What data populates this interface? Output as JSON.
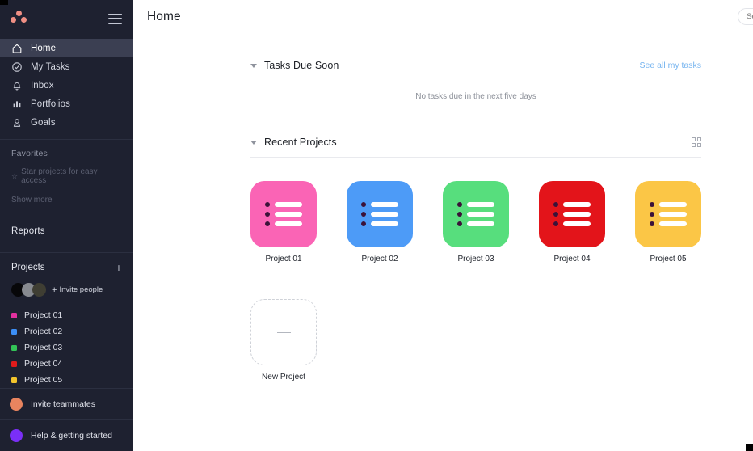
{
  "theme": {
    "sidebar_bg": "#1e2130",
    "sidebar_active_bg": "#3b3f52",
    "accent_link": "#74b3ef",
    "logo_color": "#ef8f84"
  },
  "sidebar": {
    "logo_name": "asana-logo",
    "menu_toggle_label": "",
    "nav_items": [
      {
        "label": "Home",
        "icon": "home-icon",
        "active": true
      },
      {
        "label": "My Tasks",
        "icon": "check-circle-icon",
        "active": false
      },
      {
        "label": "Inbox",
        "icon": "bell-icon",
        "active": false
      },
      {
        "label": "Portfolios",
        "icon": "bar-chart-icon",
        "active": false
      },
      {
        "label": "Goals",
        "icon": "goal-person-icon",
        "active": false
      }
    ],
    "favorites": {
      "title": "Favorites",
      "empty_hint": "Star projects for easy access",
      "show_more": "Show more"
    },
    "reports": {
      "title": "Reports"
    },
    "projects": {
      "title": "Projects",
      "add_label": "+",
      "invite_people": "Invite people",
      "avatars": [
        "#070709",
        "#878a90",
        "#3f3e33"
      ],
      "items": [
        {
          "label": "Project 01",
          "color": "#e2309f"
        },
        {
          "label": "Project 02",
          "color": "#3c8ef5"
        },
        {
          "label": "Project 03",
          "color": "#33c457"
        },
        {
          "label": "Project 04",
          "color": "#e01b1b"
        },
        {
          "label": "Project 05",
          "color": "#f2c42c"
        }
      ]
    },
    "footer": [
      {
        "label": "Invite teammates",
        "color": "#e8845f",
        "icon": "invite-teammates-icon"
      },
      {
        "label": "Help & getting started",
        "color": "#7a2ff7",
        "icon": "help-icon"
      }
    ]
  },
  "header": {
    "title": "Home",
    "search_placeholder": "Search...",
    "search_value": ""
  },
  "tasks_section": {
    "title": "Tasks Due Soon",
    "see_all_link": "See all my tasks",
    "empty_message": "No tasks due in the next five days"
  },
  "projects_section": {
    "title": "Recent Projects",
    "view_icon": "grid-view-icon",
    "cards": [
      {
        "label": "Project 01",
        "color": "#fa64b5"
      },
      {
        "label": "Project 02",
        "color": "#4d9bf7"
      },
      {
        "label": "Project 03",
        "color": "#57de7d"
      },
      {
        "label": "Project 04",
        "color": "#e3141a"
      },
      {
        "label": "Project 05",
        "color": "#fbc646"
      }
    ],
    "new_project": {
      "label": "New Project",
      "icon": "plus-icon"
    }
  }
}
